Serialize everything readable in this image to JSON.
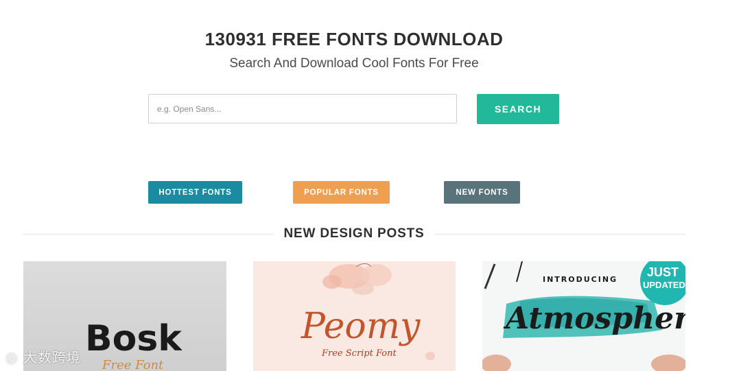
{
  "header": {
    "title": "130931 FREE FONTS DOWNLOAD",
    "subtitle": "Search And Download Cool Fonts For Free"
  },
  "search": {
    "placeholder": "e.g. Open Sans...",
    "button_label": "SEARCH"
  },
  "categories": {
    "hottest": "HOTTEST FONTS",
    "popular": "POPULAR FONTS",
    "new": "NEW FONTS"
  },
  "section": {
    "title": "NEW DESIGN POSTS"
  },
  "posts": [
    {
      "title": "Bosk",
      "tagline": "Free Font"
    },
    {
      "title": "Peomy",
      "tagline": "Free Script Font"
    },
    {
      "title": "Atmosphere",
      "tagline": "INTRODUCING",
      "badge_line1": "JUST",
      "badge_line2": "UPDATED"
    }
  ],
  "watermark": "大数跨境",
  "colors": {
    "search_button": "#22b99a",
    "hottest": "#1a8ba0",
    "popular": "#ee9f4f",
    "new": "#58737a"
  }
}
